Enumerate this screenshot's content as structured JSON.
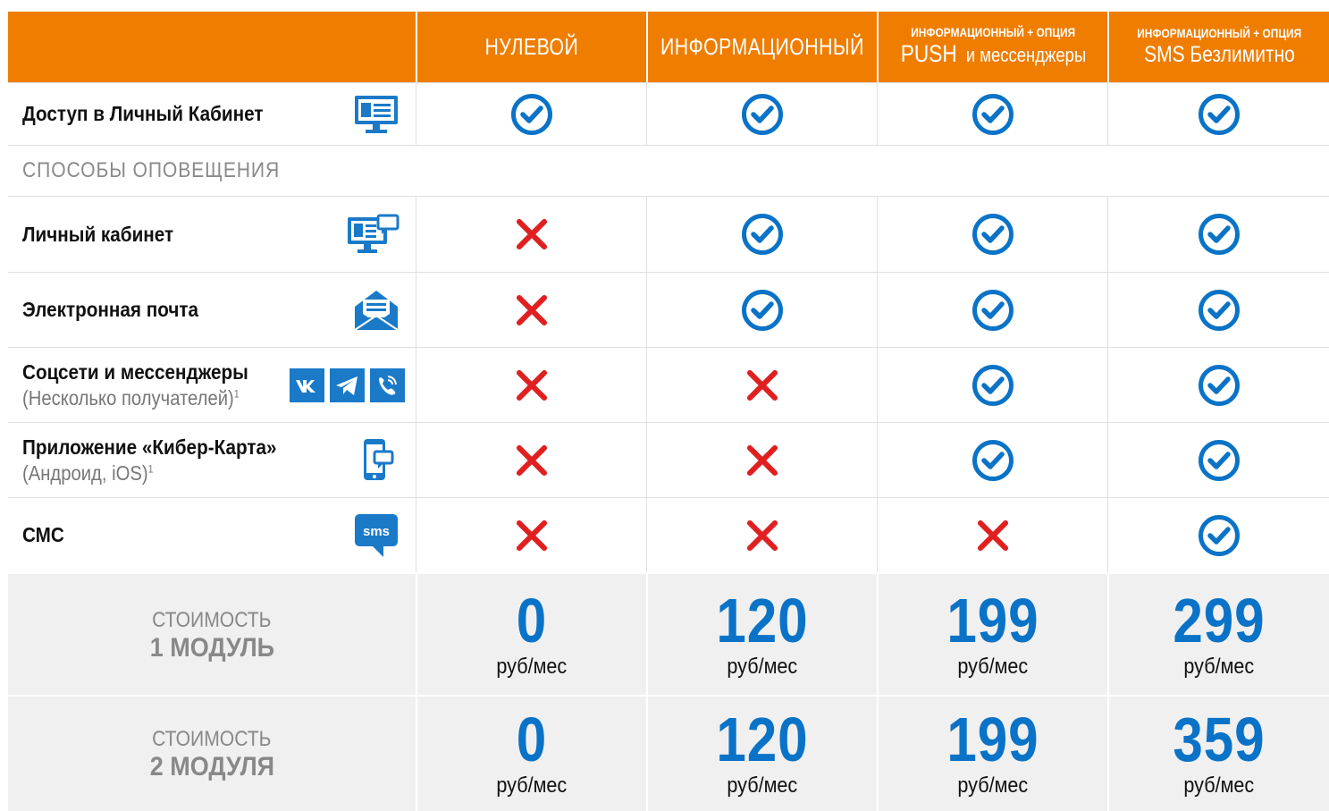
{
  "header": {
    "col1": "НУЛЕВОЙ",
    "col2": "ИНФОРМАЦИОННЫЙ",
    "col3_small": "ИНФОРМАЦИОННЫЙ + ОПЦИЯ",
    "col3_main": "PUSH",
    "col3_tail": "и мессенджеры",
    "col4_small": "ИНФОРМАЦИОННЫЙ + ОПЦИЯ",
    "col4_main": "SMS Безлимитно"
  },
  "rows": {
    "access": {
      "label": "Доступ в Личный Кабинет",
      "icon": "monitor-id-card-icon",
      "values": [
        "check",
        "check",
        "check",
        "check"
      ]
    },
    "section_title": "СПОСОБЫ  ОПОВЕЩЕНИЯ",
    "cabinet": {
      "label": "Личный кабинет",
      "icon": "monitor-chat-icon",
      "values": [
        "cross",
        "check",
        "check",
        "check"
      ]
    },
    "email": {
      "label": "Электронная почта",
      "icon": "envelope-icon",
      "values": [
        "cross",
        "check",
        "check",
        "check"
      ]
    },
    "social": {
      "label": "Соцсети и мессенджеры",
      "sublabel": "(Несколько получателей)",
      "footnote": "1",
      "icons": [
        "vk-icon",
        "telegram-icon",
        "viber-icon"
      ],
      "values": [
        "cross",
        "cross",
        "check",
        "check"
      ]
    },
    "app": {
      "label": "Приложение «Кибер-Карта»",
      "sublabel": "(Андроид, iOS)",
      "footnote": "1",
      "icon": "phone-chat-icon",
      "values": [
        "cross",
        "cross",
        "check",
        "check"
      ]
    },
    "sms": {
      "label": "СМС",
      "icon": "sms-icon",
      "icon_text": "sms",
      "values": [
        "cross",
        "cross",
        "cross",
        "check"
      ]
    }
  },
  "pricing": {
    "module1": {
      "label1": "СТОИМОСТЬ",
      "label2": "1 МОДУЛЬ",
      "prices": [
        "0",
        "120",
        "199",
        "299"
      ],
      "unit": "руб/мес"
    },
    "module2": {
      "label1": "СТОИМОСТЬ",
      "label2": "2 МОДУЛЯ",
      "prices": [
        "0",
        "120",
        "199",
        "359"
      ],
      "unit": "руб/мес"
    }
  },
  "colors": {
    "header_bg": "#ef7d00",
    "check": "#0a73c7",
    "cross": "#e02020",
    "price": "#0a73c7",
    "icon_blue": "#1a7ac8"
  }
}
